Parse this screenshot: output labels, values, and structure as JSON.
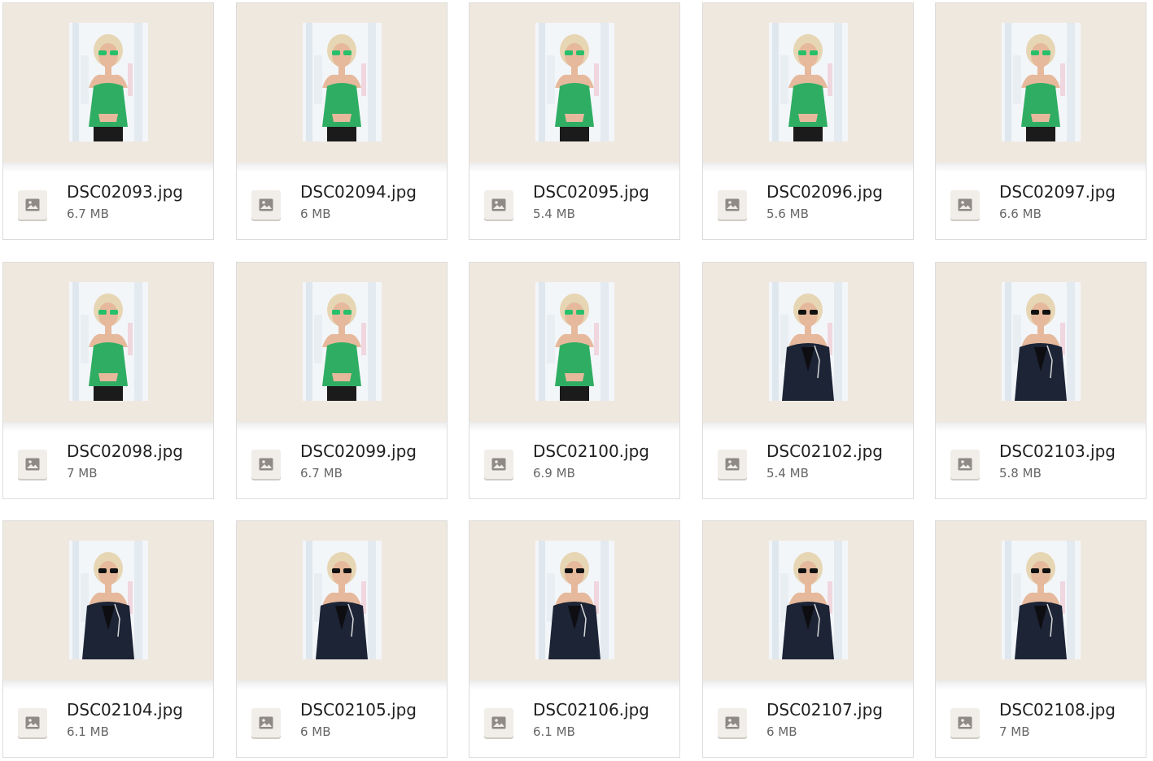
{
  "files": [
    {
      "name": "DSC02093.jpg",
      "size": "6.7 MB",
      "outfit": "green-top"
    },
    {
      "name": "DSC02094.jpg",
      "size": "6 MB",
      "outfit": "green-top"
    },
    {
      "name": "DSC02095.jpg",
      "size": "5.4 MB",
      "outfit": "green-top"
    },
    {
      "name": "DSC02096.jpg",
      "size": "5.6 MB",
      "outfit": "green-top"
    },
    {
      "name": "DSC02097.jpg",
      "size": "6.6 MB",
      "outfit": "green-top"
    },
    {
      "name": "DSC02098.jpg",
      "size": "7 MB",
      "outfit": "green-top"
    },
    {
      "name": "DSC02099.jpg",
      "size": "6.7 MB",
      "outfit": "green-top"
    },
    {
      "name": "DSC02100.jpg",
      "size": "6.9 MB",
      "outfit": "green-top"
    },
    {
      "name": "DSC02102.jpg",
      "size": "5.4 MB",
      "outfit": "navy-blazer"
    },
    {
      "name": "DSC02103.jpg",
      "size": "5.8 MB",
      "outfit": "navy-blazer"
    },
    {
      "name": "DSC02104.jpg",
      "size": "6.1 MB",
      "outfit": "navy-blazer"
    },
    {
      "name": "DSC02105.jpg",
      "size": "6 MB",
      "outfit": "navy-blazer"
    },
    {
      "name": "DSC02106.jpg",
      "size": "6.1 MB",
      "outfit": "navy-blazer"
    },
    {
      "name": "DSC02107.jpg",
      "size": "6 MB",
      "outfit": "navy-blazer"
    },
    {
      "name": "DSC02108.jpg",
      "size": "7 MB",
      "outfit": "navy-blazer"
    }
  ],
  "icons": {
    "file_type": "image-file-icon"
  },
  "colors": {
    "preview_bg": "#efe8df",
    "green_top": "#2fae63",
    "navy_blazer": "#1c2436",
    "hair": "#e6d6b4",
    "skin": "#e6b99c"
  }
}
